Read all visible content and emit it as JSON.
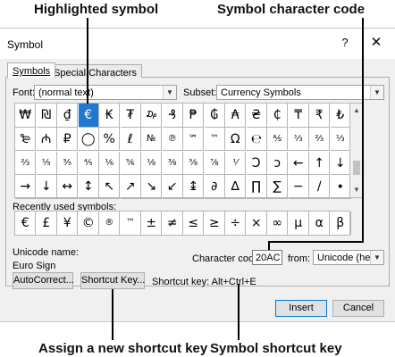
{
  "callouts": {
    "highlighted_symbol": "Highlighted symbol",
    "character_code": "Symbol character code",
    "assign_shortcut": "Assign a new shortcut key",
    "shortcut_key": "Symbol shortcut key"
  },
  "dialog": {
    "title": "Symbol",
    "help": "?",
    "close": "✕"
  },
  "tabs": [
    {
      "label": "Symbols",
      "active": true
    },
    {
      "label": "Special Characters",
      "active": false
    }
  ],
  "font": {
    "label": "Font:",
    "value": "(normal text)"
  },
  "subset": {
    "label": "Subset:",
    "value": "Currency Symbols"
  },
  "symbols": [
    [
      "₩",
      "₪",
      "₫",
      "€",
      "₭",
      "₮",
      "₯",
      "₰",
      "₱",
      "₲",
      "₳",
      "₴",
      "₵",
      "₸",
      "₹",
      "₺"
    ],
    [
      "₻",
      "₼",
      "₽",
      "◯",
      "%",
      "ℓ",
      "№",
      "℗",
      "℠",
      "™",
      "Ω",
      "℮",
      "⅍",
      "⅓",
      "⅔",
      "⅓"
    ],
    [
      "⅔",
      "⅕",
      "⅗",
      "⅘",
      "⅙",
      "⅚",
      "⅛",
      "⅜",
      "⅝",
      "⅞",
      "⅟",
      "Ↄ",
      "ↄ",
      "←",
      "↑",
      "↓"
    ],
    [
      "→",
      "↓",
      "↔",
      "↕",
      "↖",
      "↗",
      "↘",
      "↙",
      "↨",
      "∂",
      "∆",
      "∏",
      "∑",
      "−",
      "∕",
      "∙"
    ]
  ],
  "symbols_display": [
    [
      "₩",
      "₪",
      "₫",
      "€",
      "₭",
      "₮",
      "₯",
      "₰",
      "₱",
      "₲",
      "₳",
      "₴",
      "₵",
      "₸",
      "₹",
      "₺"
    ],
    [
      "₻",
      "₼",
      "₽",
      "◯",
      "%",
      "ℓ",
      "№",
      "℗",
      "℠",
      "™",
      "Ω",
      "℮",
      "⅍",
      "⅓",
      "",
      " "
    ],
    [
      "⅔",
      "⅖",
      "⅗",
      "⅘",
      "⅙",
      "⅚",
      "⅛",
      "⅜",
      "⅝",
      "⅞",
      "⅟",
      "Ↄ",
      "ↄ",
      "←",
      "↑",
      ""
    ],
    [
      "→",
      "↓",
      "↔",
      "↕",
      "↖",
      "↗",
      "↘",
      "↙",
      "↨",
      "∂",
      "∆",
      "∏",
      "∑",
      "−",
      "∕",
      "∙"
    ]
  ],
  "selected_symbol": {
    "row": 0,
    "col": 3
  },
  "recent": {
    "label": "Recently used symbols:",
    "items": [
      "€",
      "£",
      "¥",
      "©",
      "®",
      "™",
      "±",
      "≠",
      "≤",
      "≥",
      "÷",
      "×",
      "∞",
      "µ",
      "α",
      "β"
    ]
  },
  "unicode": {
    "label": "Unicode name:",
    "name": "Euro Sign"
  },
  "char_code": {
    "label": "Character code:",
    "value": "20AC"
  },
  "from": {
    "label": "from:",
    "value": "Unicode (hex)"
  },
  "buttons": {
    "autocorrect": "AutoCorrect...",
    "shortcut_key": "Shortcut Key...",
    "insert": "Insert",
    "cancel": "Cancel"
  },
  "shortcut_text": "Shortcut key: Alt+Ctrl+E"
}
